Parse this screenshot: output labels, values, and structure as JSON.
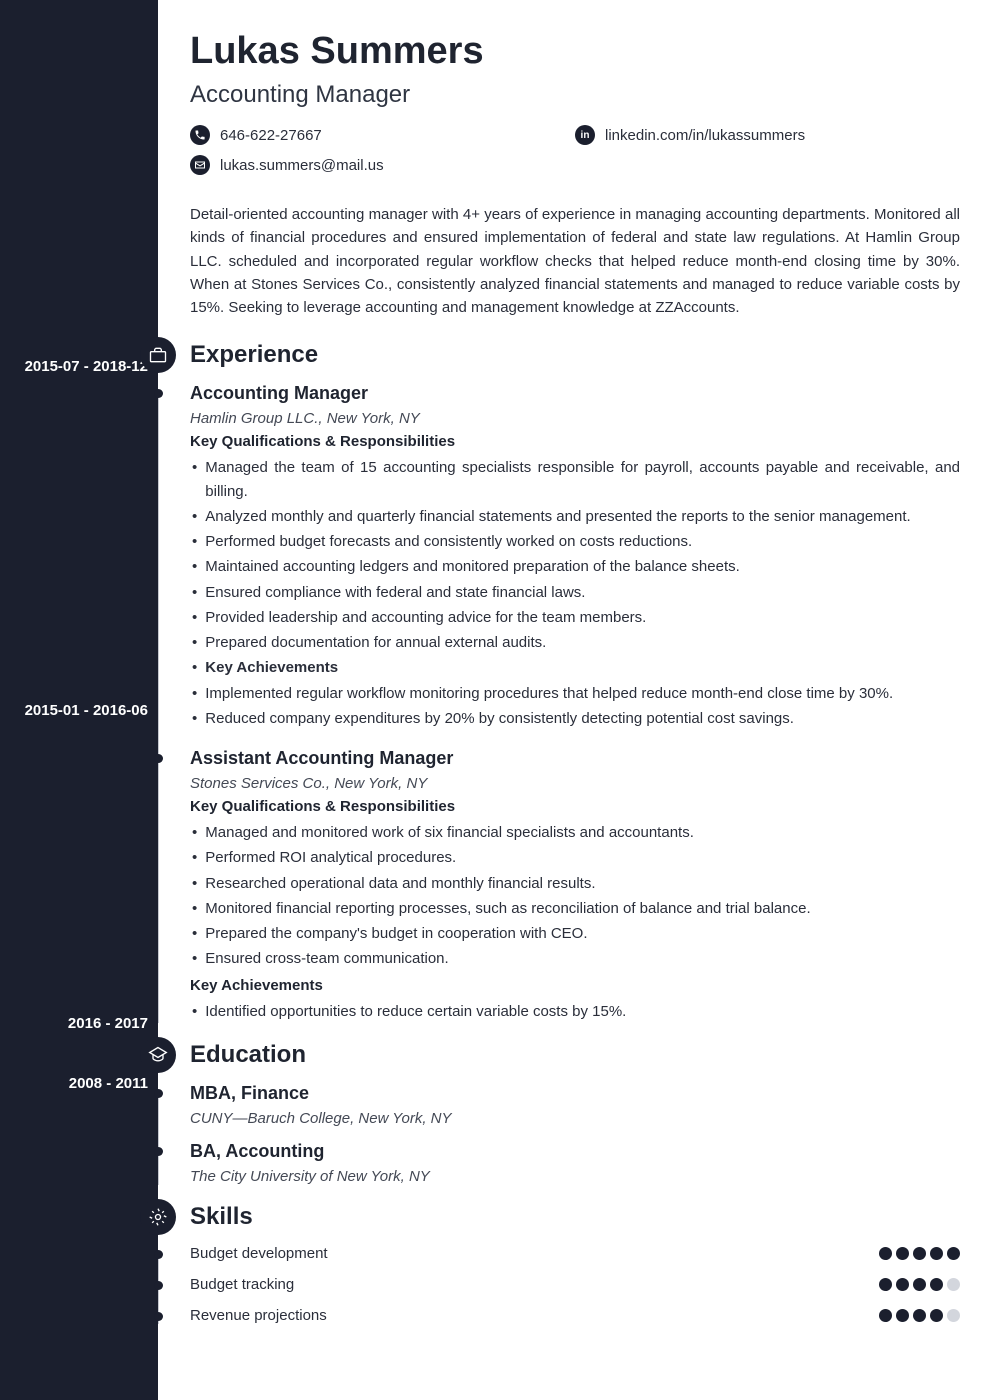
{
  "name": "Lukas Summers",
  "title": "Accounting Manager",
  "contacts": {
    "phone": "646-622-27667",
    "linkedin": "linkedin.com/in/lukassummers",
    "email": "lukas.summers@mail.us"
  },
  "summary": "Detail-oriented accounting manager with 4+ years of experience in managing accounting departments. Monitored all kinds of financial procedures and ensured implementation of federal and state law regulations. At Hamlin Group LLC. scheduled and incorporated regular workflow checks that helped reduce month-end closing time by 30%. When at Stones Services Co., consistently analyzed financial statements and managed to reduce variable costs by 15%. Seeking to leverage accounting and management knowledge at ZZAccounts.",
  "sections": {
    "experience": {
      "title": "Experience",
      "entries": [
        {
          "dates": "2015-07 - 2018-12",
          "role": "Accounting Manager",
          "company": "Hamlin Group LLC., New York, NY",
          "qual_label": "Key Qualifications & Responsibilities",
          "bullets": [
            "Managed the team of 15 accounting specialists responsible for payroll, accounts payable and receivable, and billing.",
            "Analyzed monthly and quarterly financial statements and presented the reports to the senior management.",
            "Performed budget forecasts and consistently worked on costs reductions.",
            "Maintained accounting ledgers and monitored preparation of the balance sheets.",
            "Ensured compliance with federal and state financial laws.",
            "Provided leadership and accounting advice for the team members.",
            "Prepared documentation for annual external audits.",
            "Key Achievements",
            "Implemented regular workflow monitoring procedures that helped reduce month-end close time by 30%.",
            "Reduced company expenditures by 20% by consistently detecting potential cost savings."
          ],
          "bold_index": 7
        },
        {
          "dates": "2015-01 - 2016-06",
          "role": "Assistant Accounting Manager",
          "company": "Stones Services Co., New York, NY",
          "qual_label": "Key Qualifications & Responsibilities",
          "bullets": [
            "Managed and monitored work of six financial specialists and accountants.",
            "Performed ROI analytical procedures.",
            "Researched operational data and monthly financial results.",
            "Monitored financial reporting processes, such as reconciliation of balance and trial balance.",
            "Prepared the company's budget in cooperation with CEO.",
            "Ensured cross-team communication."
          ],
          "ach_label": "Key Achievements",
          "ach_bullets": [
            "Identified opportunities to reduce certain variable costs by 15%."
          ]
        }
      ]
    },
    "education": {
      "title": "Education",
      "entries": [
        {
          "dates": "2016 - 2017",
          "degree": "MBA, Finance",
          "school": "CUNY—Baruch College, New York, NY"
        },
        {
          "dates": "2008 - 2011",
          "degree": "BA, Accounting",
          "school": "The City University of New York, NY"
        }
      ]
    },
    "skills": {
      "title": "Skills",
      "entries": [
        {
          "name": "Budget development",
          "rating": 5
        },
        {
          "name": "Budget tracking",
          "rating": 4
        },
        {
          "name": "Revenue projections",
          "rating": 4
        }
      ]
    }
  }
}
